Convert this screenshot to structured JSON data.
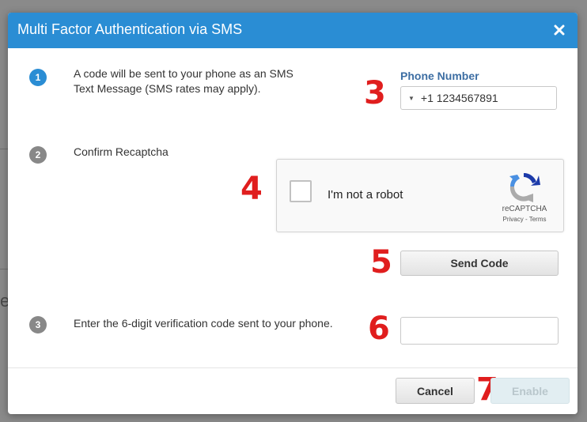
{
  "modal": {
    "title": "Multi Factor Authentication via SMS",
    "close_icon": "close-icon"
  },
  "steps": [
    {
      "number": "1",
      "text": "A code will be sent to your phone as an SMS Text Message (SMS rates may apply)."
    },
    {
      "number": "2",
      "text": "Confirm Recaptcha"
    },
    {
      "number": "3",
      "text": "Enter the 6-digit verification code sent to your phone."
    }
  ],
  "phone": {
    "label": "Phone Number",
    "value": "+1 1234567891",
    "caret_icon": "caret-down-icon"
  },
  "recaptcha": {
    "label": "I'm not a robot",
    "brand": "reCAPTCHA",
    "links": "Privacy - Terms",
    "logo_icon": "recaptcha-logo-icon"
  },
  "send_button": {
    "label": "Send Code"
  },
  "code_input": {
    "value": "",
    "placeholder": ""
  },
  "footer": {
    "cancel_label": "Cancel",
    "enable_label": "Enable"
  },
  "annotations": [
    "3",
    "4",
    "5",
    "6",
    "7"
  ],
  "background": {
    "fragment": "e"
  },
  "colors": {
    "header": "#2a8dd4",
    "step_active": "#2a8dd4",
    "step_inactive": "#888888",
    "annotation": "#e01e1e",
    "label": "#3d6ea3"
  }
}
